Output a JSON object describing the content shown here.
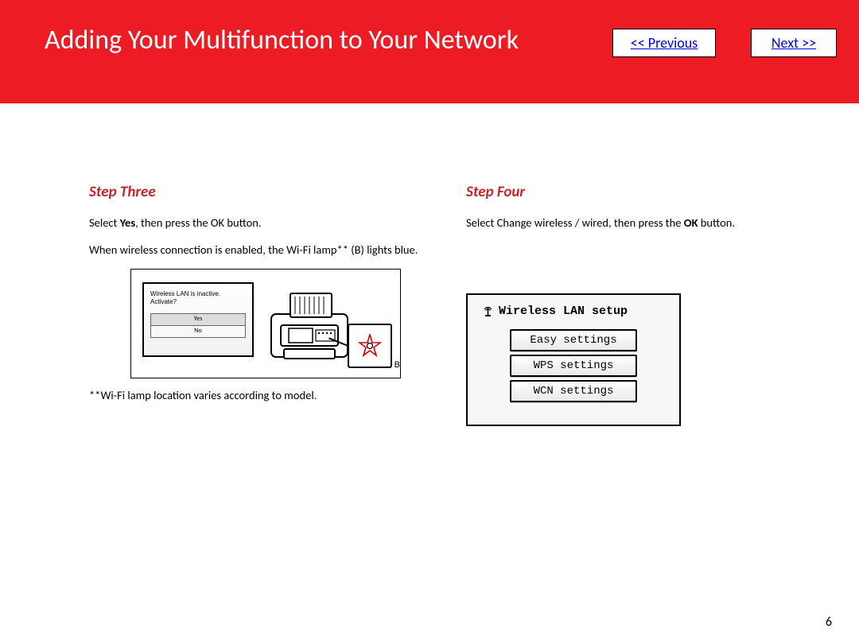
{
  "header": {
    "title": "Adding Your Multifunction to Your Network",
    "prev_label": "<< Previous",
    "next_label": "Next >>"
  },
  "step3": {
    "heading": "Step Three",
    "instr1_pre": "Select ",
    "instr1_bold": "Yes",
    "instr1_post": ", then press the OK button.",
    "instr2": "When wireless connection is enabled, the Wi-Fi lamp** (B) lights blue.",
    "footnote": "**Wi-Fi lamp location varies according to model.",
    "dialog": {
      "line1": "Wireless LAN is inactive.",
      "line2": "Activate?",
      "opt_yes": "Yes",
      "opt_no": "No"
    },
    "callout_label": "B"
  },
  "step4": {
    "heading": "Step Four",
    "instr1_pre": "Select Change wireless / wired, then press the ",
    "instr1_bold": "OK",
    "instr1_post": " button.",
    "panel_title": "Wireless LAN setup",
    "buttons": [
      "Easy settings",
      "WPS settings",
      "WCN settings"
    ]
  },
  "page_number": "6"
}
